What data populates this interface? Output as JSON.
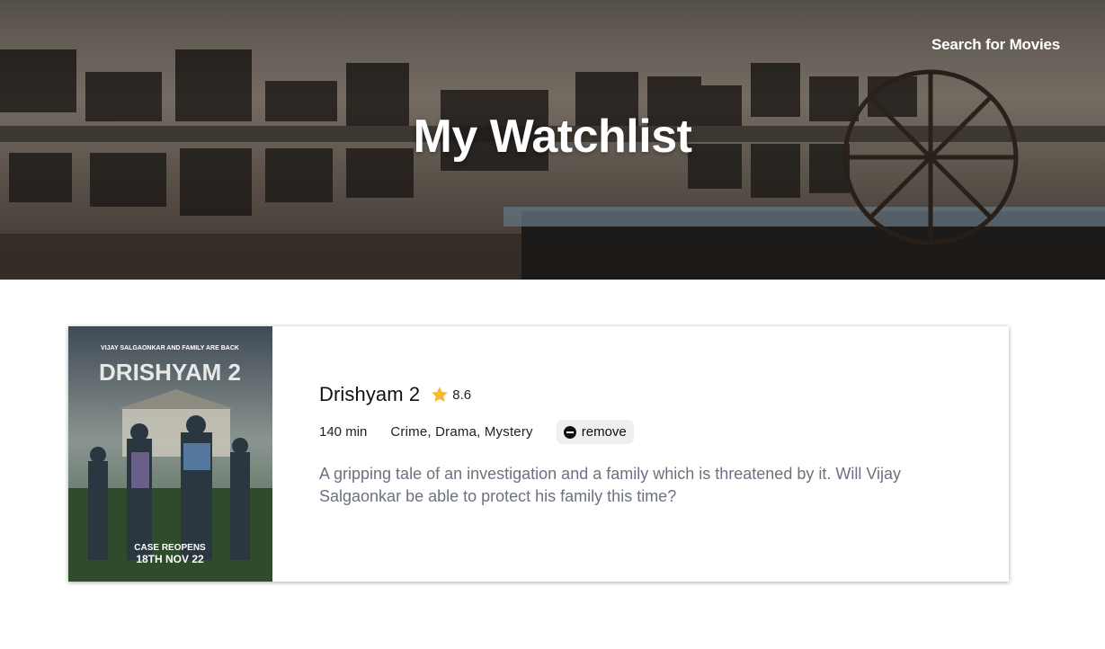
{
  "nav": {
    "search_link": "Search for Movies"
  },
  "hero": {
    "title": "My Watchlist",
    "background_image": "museum exhibit wall photo (Gandhi and Cinema timeline) with spinning wheel"
  },
  "watchlist": [
    {
      "title": "Drishyam 2",
      "rating": "8.6",
      "runtime": "140 min",
      "genres": "Crime, Drama, Mystery",
      "remove_label": "remove",
      "overview": "A gripping tale of an investigation and a family which is threatened by it. Will Vijay Salgaonkar be able to protect his family this time?",
      "poster": {
        "tagline": "VIJAY SALGAONKAR AND FAMILY ARE BACK",
        "title": "DRISHYAM 2",
        "footer_line1": "CASE REOPENS",
        "footer_line2": "18TH NOV 22"
      }
    }
  ],
  "icons": {
    "star": "star-icon",
    "remove": "minus-circle-icon"
  },
  "colors": {
    "star": "#f5b82e",
    "overview_text": "#6b7280",
    "remove_bg": "#efefef"
  }
}
